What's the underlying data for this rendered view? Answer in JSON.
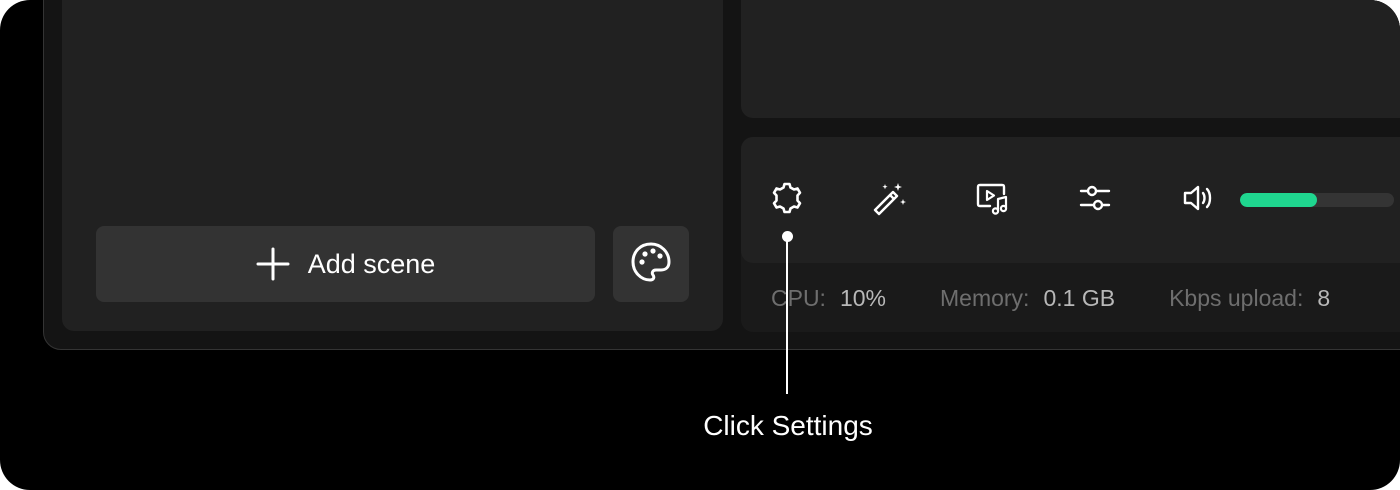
{
  "scenes": {
    "add_scene_label": "Add scene",
    "add_icon": "plus-icon",
    "theme_icon": "palette-icon"
  },
  "toolbar": {
    "items": [
      {
        "name": "settings",
        "icon": "gear-icon"
      },
      {
        "name": "studio-mode",
        "icon": "magic-wand-icon"
      },
      {
        "name": "media",
        "icon": "media-play-music-icon"
      },
      {
        "name": "adjustments",
        "icon": "sliders-icon"
      },
      {
        "name": "volume",
        "icon": "speaker-icon"
      }
    ],
    "volume_level": 0.5,
    "accent_color": "#1fd68f"
  },
  "stats": {
    "cpu_label": "CPU:",
    "cpu_value": "10%",
    "memory_label": "Memory:",
    "memory_value": "0.1 GB",
    "upload_label": "Kbps upload:",
    "upload_value": "8"
  },
  "callout": {
    "text": "Click Settings"
  }
}
